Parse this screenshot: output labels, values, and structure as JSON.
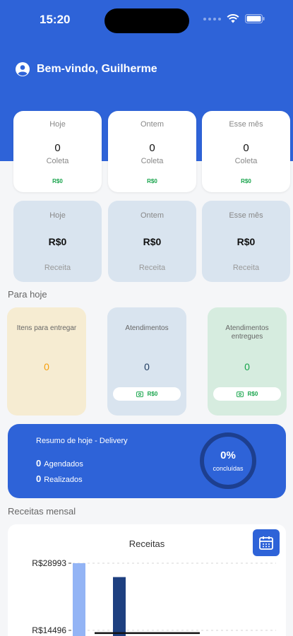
{
  "status_bar": {
    "time": "15:20"
  },
  "header": {
    "welcome": "Bem-vindo, Guilherme"
  },
  "coleta_cards": [
    {
      "label": "Hoje",
      "value": "0",
      "sub": "Coleta",
      "money": "R$0"
    },
    {
      "label": "Ontem",
      "value": "0",
      "sub": "Coleta",
      "money": "R$0"
    },
    {
      "label": "Esse mês",
      "value": "0",
      "sub": "Coleta",
      "money": "R$0"
    }
  ],
  "receita_cards": [
    {
      "label": "Hoje",
      "value": "R$0",
      "sub": "Receita"
    },
    {
      "label": "Ontem",
      "value": "R$0",
      "sub": "Receita"
    },
    {
      "label": "Esse mês",
      "value": "R$0",
      "sub": "Receita"
    }
  ],
  "para_hoje": {
    "title": "Para hoje",
    "cards": [
      {
        "label": "Itens para entregar",
        "value": "0",
        "color": "#f59e0b",
        "bg": "#f6ecd2"
      },
      {
        "label": "Atendimentos",
        "value": "0",
        "money": "R$0",
        "color": "#1e3a5f",
        "bg": "#d9e4ef"
      },
      {
        "label": "Atendimentos entregues",
        "value": "0",
        "money": "R$0",
        "color": "#16a34a",
        "bg": "#d6ecdf"
      }
    ]
  },
  "delivery": {
    "title": "Resumo de hoje - Delivery",
    "agendados_count": "0",
    "agendados_label": "Agendados",
    "realizados_count": "0",
    "realizados_label": "Realizados",
    "percent": "0%",
    "percent_label": "concluídas",
    "progress": 0
  },
  "receitas_mensal": {
    "section_title": "Receitas mensal",
    "icon": "calendar-icon"
  },
  "colors": {
    "primary": "#2e63d8",
    "ring": "#1d3f8f",
    "success": "#16a34a"
  },
  "chart_data": {
    "type": "bar",
    "title": "Receitas",
    "ytick_labels": [
      "R$28993",
      "R$14496"
    ],
    "ytick_values": [
      28993,
      14496
    ],
    "series": [
      {
        "values": [
          28993
        ],
        "color": "#93b4f5"
      },
      {
        "values": [
          26000
        ],
        "color": "#1e4080"
      }
    ],
    "reference_line": 13900,
    "ylim": [
      0,
      28993
    ],
    "grid": true
  }
}
